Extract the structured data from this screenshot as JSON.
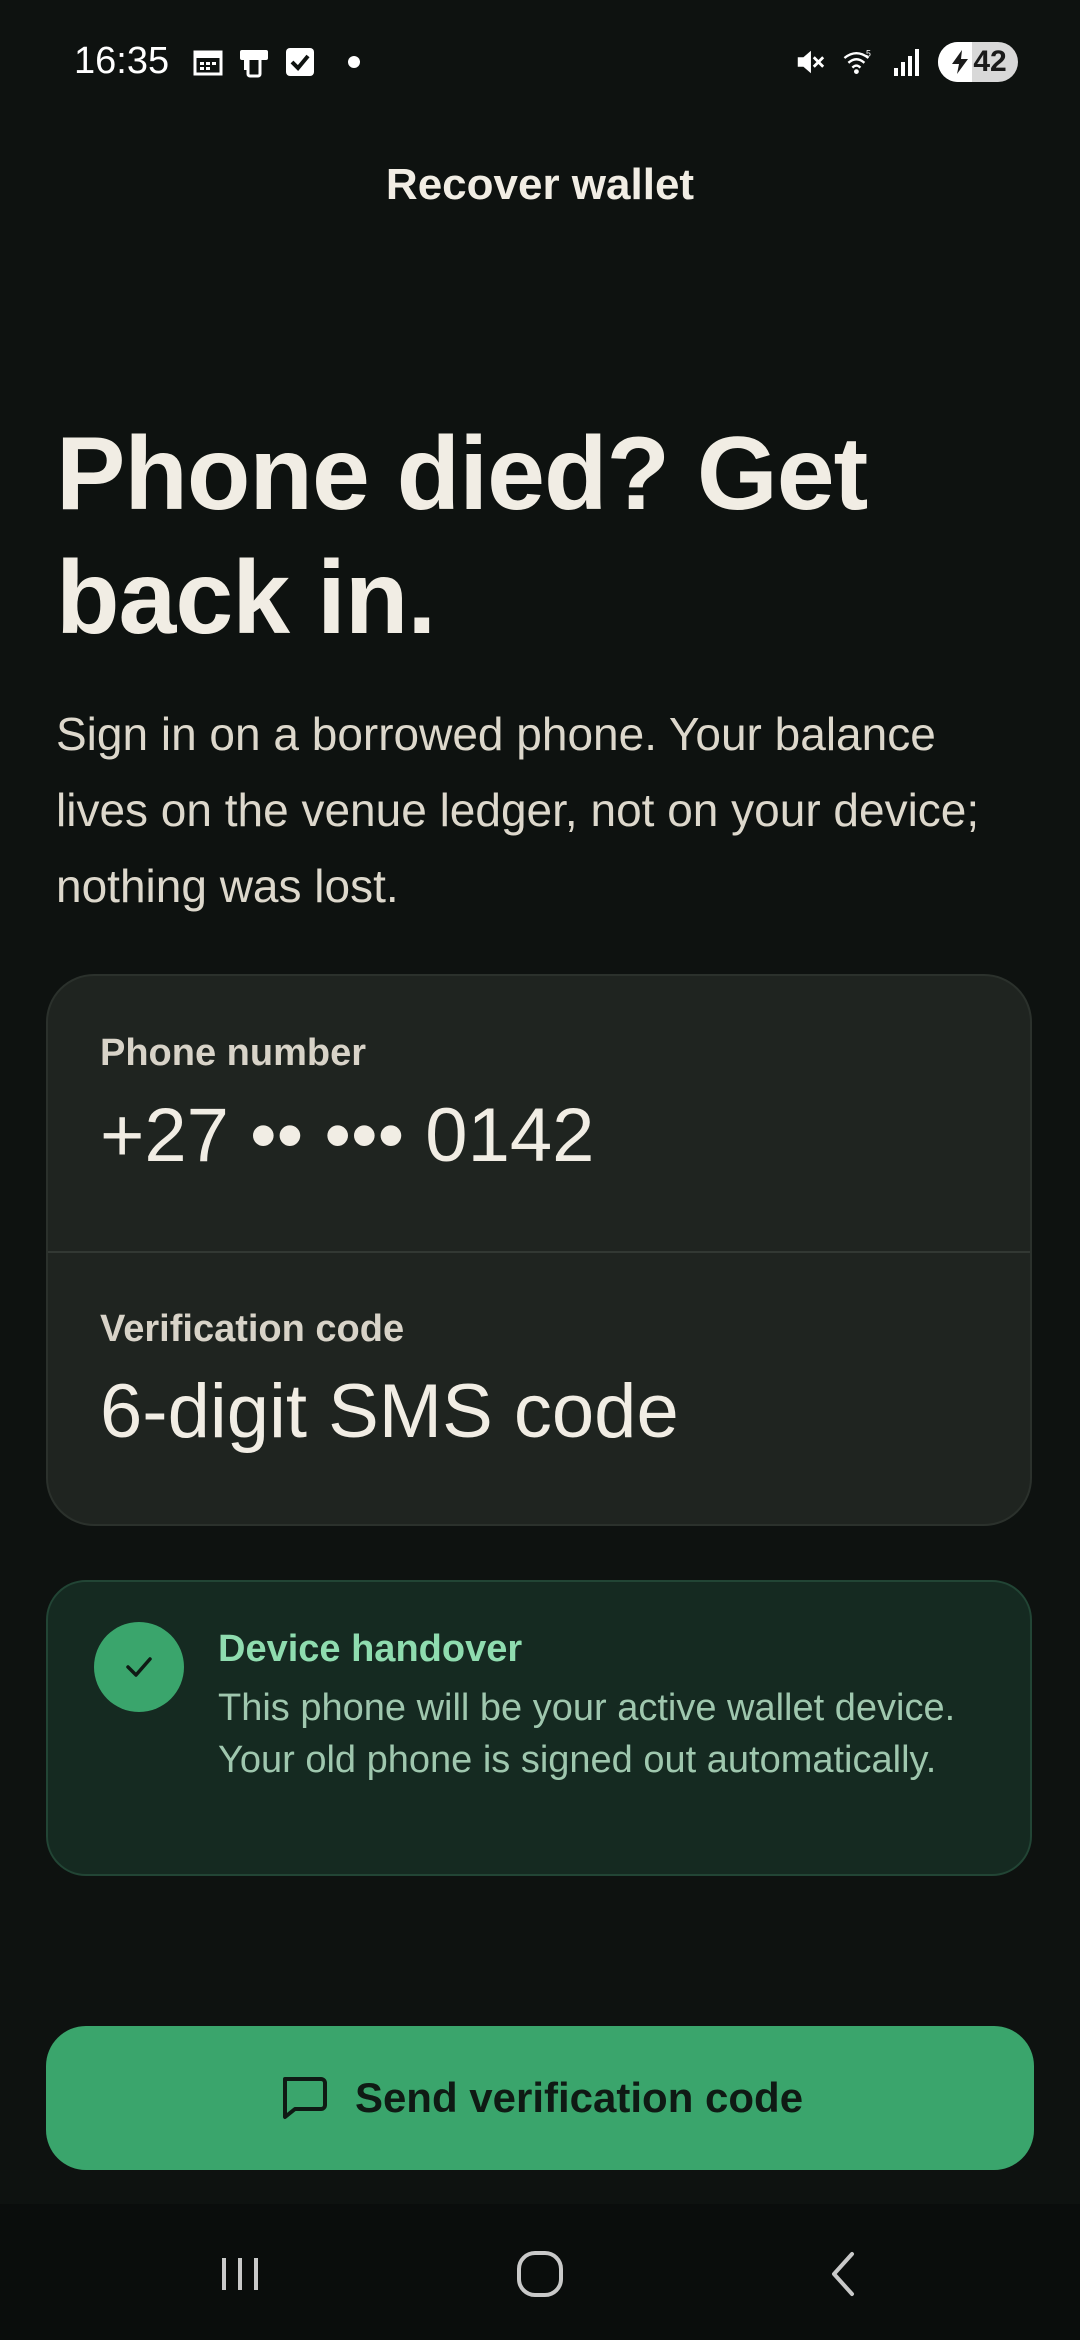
{
  "status_bar": {
    "time": "16:35",
    "battery_level": "42",
    "battery_fraction": 0.42,
    "left_icons": [
      "calendar-icon",
      "phone-transfer-icon",
      "checkbox-icon",
      "notification-dot"
    ],
    "right_icons": [
      "mute-icon",
      "wifi-icon",
      "signal-icon",
      "battery-icon"
    ]
  },
  "header": {
    "title": "Recover wallet"
  },
  "hero": {
    "title": "Phone died? Get back in.",
    "body": "Sign in on a borrowed phone. Your balance lives on the venue ledger, not on your device; nothing was lost."
  },
  "form": {
    "phone": {
      "label": "Phone number",
      "value": "+27 •• ••• 0142"
    },
    "code": {
      "label": "Verification code",
      "placeholder": "6-digit SMS code"
    }
  },
  "info": {
    "icon": "check-icon",
    "title": "Device handover",
    "text": "This phone will be your active wallet device. Your old phone is signed out automatically."
  },
  "primary_action": {
    "icon": "message-icon",
    "label": "Send verification code"
  },
  "nav": {
    "items": [
      "recents-icon",
      "home-icon",
      "back-icon"
    ]
  },
  "colors": {
    "background": "#0e1210",
    "accent": "#3aa56c",
    "card": "#1f2420",
    "info_card": "#152a21",
    "text": "#f1ede4"
  }
}
